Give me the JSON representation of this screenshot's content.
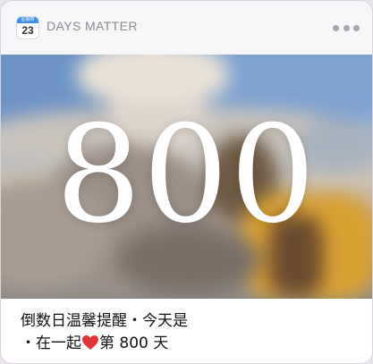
{
  "header": {
    "app_icon_day": "23",
    "app_icon_strip": "星期四",
    "app_name": "DAYS MATTER",
    "more_icon": "more-dots-icon"
  },
  "main": {
    "day_count": "800",
    "background_image": "blurred photo of girl with hat sitting by the sea"
  },
  "caption": {
    "line1": "倒数日温馨提醒・今天是",
    "line2_prefix": "・在一起",
    "heart_icon": "red-heart-icon",
    "line2_suffix": "第 800 天"
  },
  "colors": {
    "header_bg": "#f7f6f8",
    "app_name": "#8b8a8e",
    "heart": "#e5343c",
    "number": "#ffffff"
  }
}
